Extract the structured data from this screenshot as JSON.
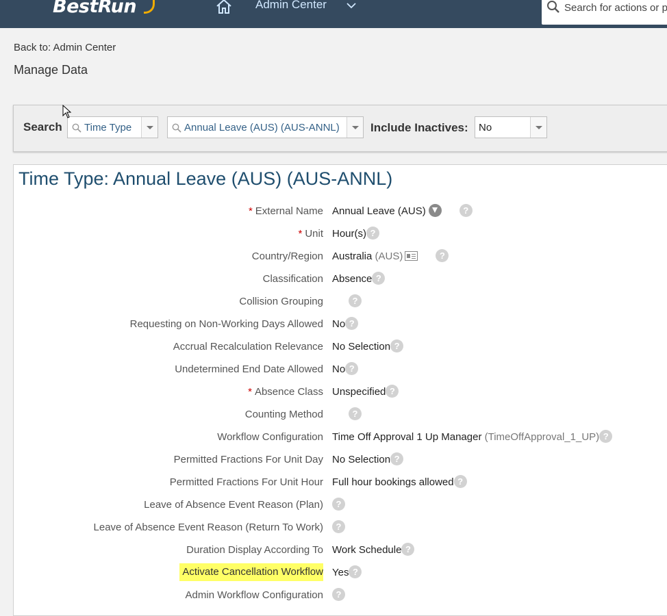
{
  "shell": {
    "brand": "BestRun",
    "app_title": "Admin Center",
    "search_placeholder": "Search for actions or p"
  },
  "header": {
    "back_link": "Back to: Admin Center",
    "page_title": "Manage Data"
  },
  "search": {
    "label": "Search",
    "object_type": "Time Type",
    "record": "Annual Leave (AUS) (AUS-ANNL)",
    "include_inactives_label": "Include Inactives:",
    "include_inactives_value": "No"
  },
  "record": {
    "title": "Time Type: Annual Leave (AUS) (AUS-ANNL)",
    "fields": [
      {
        "label": "External Name",
        "required": "*",
        "value": "Annual Leave (AUS)"
      },
      {
        "label": "Unit",
        "required": "*",
        "value": "Hour(s)"
      },
      {
        "label": "Country/Region",
        "value": "Australia",
        "code": "(AUS)"
      },
      {
        "label": "Classification",
        "value": "Absence"
      },
      {
        "label": "Collision Grouping",
        "value": ""
      },
      {
        "label": "Requesting on Non-Working Days Allowed",
        "value": "No"
      },
      {
        "label": "Accrual Recalculation Relevance",
        "value": "No Selection"
      },
      {
        "label": "Undetermined End Date Allowed",
        "value": "No"
      },
      {
        "label": "Absence Class",
        "required": "*",
        "value": "Unspecified"
      },
      {
        "label": "Counting Method",
        "value": ""
      },
      {
        "label": "Workflow Configuration",
        "value": "Time Off Approval 1 Up Manager",
        "code": "(TimeOffApproval_1_UP)"
      },
      {
        "label": "Permitted Fractions For Unit Day",
        "value": "No Selection"
      },
      {
        "label": "Permitted Fractions For Unit Hour",
        "value": "Full hour bookings allowed"
      },
      {
        "label": "Leave of Absence Event Reason (Plan)",
        "value": ""
      },
      {
        "label": "Leave of Absence Event Reason (Return To Work)",
        "value": ""
      },
      {
        "label": "Duration Display According To",
        "value": "Work Schedule"
      },
      {
        "label": "Activate Cancellation Workflow",
        "value": "Yes",
        "highlight_color": "#ffff66"
      },
      {
        "label": "Admin Workflow Configuration",
        "value": ""
      }
    ],
    "help_glyph": "?"
  },
  "icons": [
    "home-icon",
    "chevron-down-icon",
    "search-icon",
    "ranking-icon",
    "card-icon",
    "help-icon",
    "cursor-icon"
  ],
  "colors": {
    "shell": "#354a5f",
    "brand_accent": "#f0ab00",
    "title": "#1f4e6e",
    "link": "#346187",
    "required": "#cc0000"
  }
}
